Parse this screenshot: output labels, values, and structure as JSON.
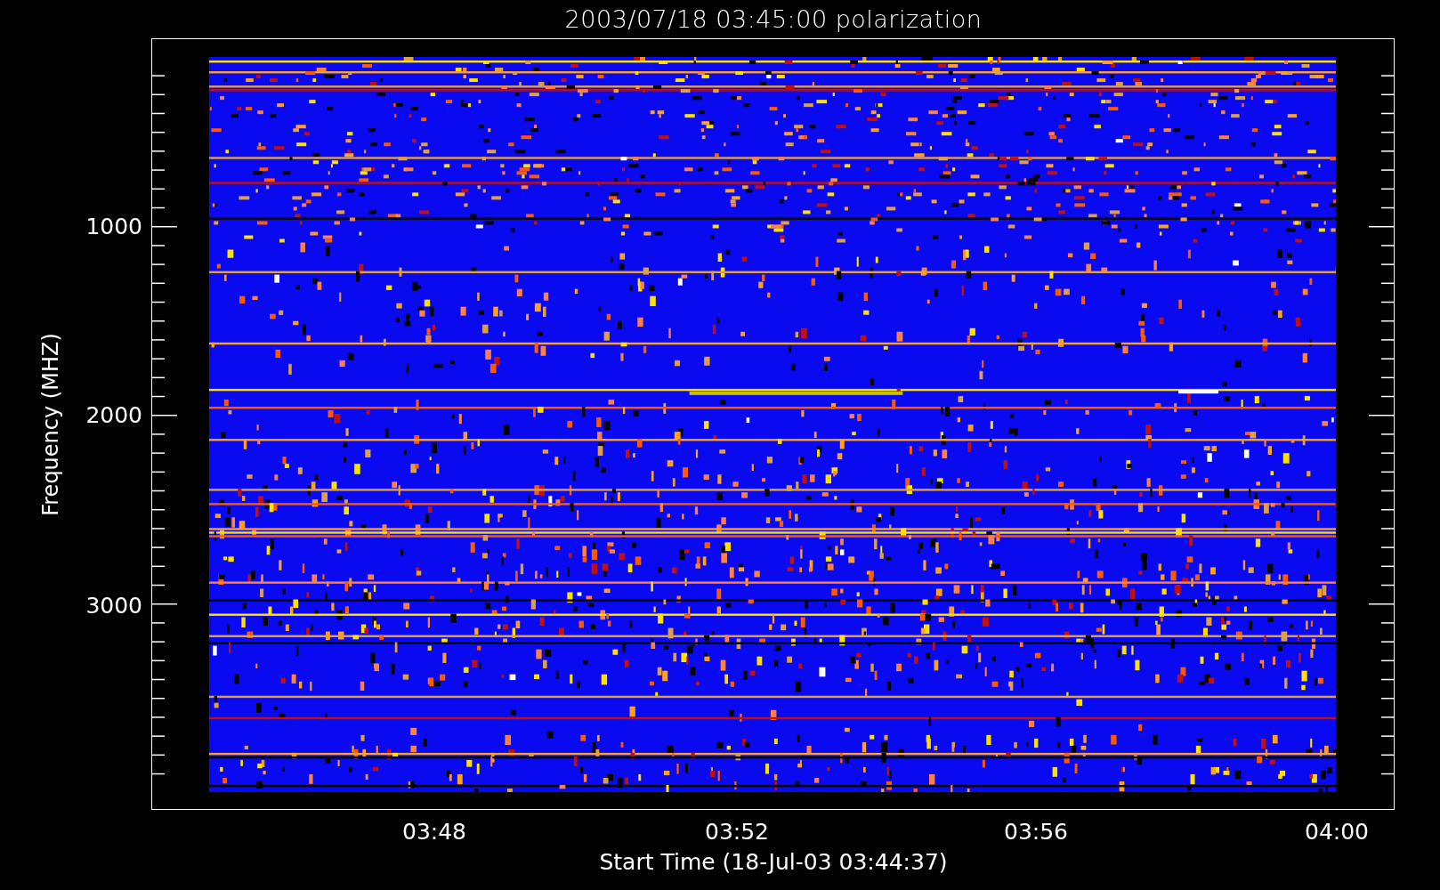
{
  "title": "2003/07/18 03:45:00 polarization",
  "y_axis": {
    "label": "Frequency (MHZ)",
    "ticks": [
      "1000",
      "2000",
      "3000"
    ]
  },
  "x_axis": {
    "label": "Start Time (18-Jul-03 03:44:37)",
    "ticks": [
      "03:48",
      "03:52",
      "03:56",
      "04:00"
    ]
  }
}
